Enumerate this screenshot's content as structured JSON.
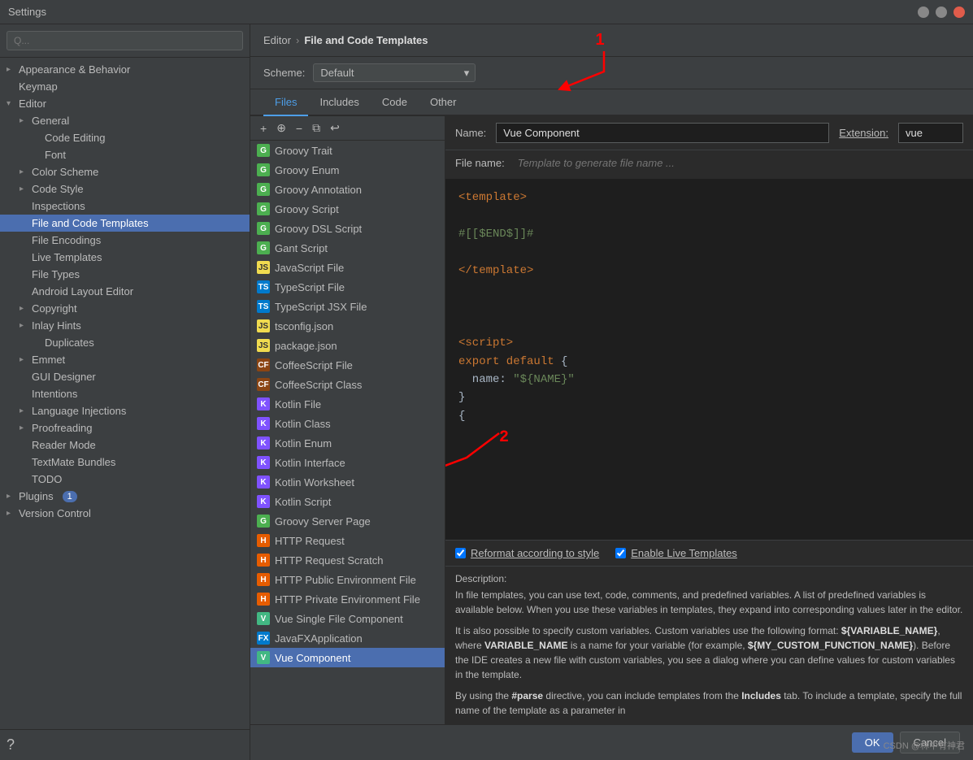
{
  "titleBar": {
    "title": "Settings"
  },
  "search": {
    "placeholder": "Q..."
  },
  "sidebar": {
    "sections": [
      {
        "id": "appearance",
        "label": "Appearance & Behavior",
        "level": 0,
        "hasArrow": true,
        "expanded": false
      },
      {
        "id": "keymap",
        "label": "Keymap",
        "level": 0,
        "hasArrow": false
      },
      {
        "id": "editor",
        "label": "Editor",
        "level": 0,
        "hasArrow": true,
        "expanded": true
      },
      {
        "id": "general",
        "label": "General",
        "level": 1,
        "hasArrow": true
      },
      {
        "id": "code-editing",
        "label": "Code Editing",
        "level": 2,
        "hasArrow": false
      },
      {
        "id": "font",
        "label": "Font",
        "level": 2,
        "hasArrow": false
      },
      {
        "id": "color-scheme",
        "label": "Color Scheme",
        "level": 1,
        "hasArrow": true
      },
      {
        "id": "code-style",
        "label": "Code Style",
        "level": 1,
        "hasArrow": true
      },
      {
        "id": "inspections",
        "label": "Inspections",
        "level": 1,
        "hasArrow": false
      },
      {
        "id": "file-code-templates",
        "label": "File and Code Templates",
        "level": 1,
        "hasArrow": false,
        "selected": true
      },
      {
        "id": "file-encodings",
        "label": "File Encodings",
        "level": 1,
        "hasArrow": false
      },
      {
        "id": "live-templates",
        "label": "Live Templates",
        "level": 1,
        "hasArrow": false
      },
      {
        "id": "file-types",
        "label": "File Types",
        "level": 1,
        "hasArrow": false
      },
      {
        "id": "android-layout",
        "label": "Android Layout Editor",
        "level": 1,
        "hasArrow": false
      },
      {
        "id": "copyright",
        "label": "Copyright",
        "level": 1,
        "hasArrow": true
      },
      {
        "id": "inlay-hints",
        "label": "Inlay Hints",
        "level": 1,
        "hasArrow": true
      },
      {
        "id": "duplicates",
        "label": "Duplicates",
        "level": 2,
        "hasArrow": false
      },
      {
        "id": "emmet",
        "label": "Emmet",
        "level": 1,
        "hasArrow": true
      },
      {
        "id": "gui-designer",
        "label": "GUI Designer",
        "level": 1,
        "hasArrow": false
      },
      {
        "id": "intentions",
        "label": "Intentions",
        "level": 1,
        "hasArrow": false
      },
      {
        "id": "language-injections",
        "label": "Language Injections",
        "level": 1,
        "hasArrow": true
      },
      {
        "id": "proofreading",
        "label": "Proofreading",
        "level": 1,
        "hasArrow": true
      },
      {
        "id": "reader-mode",
        "label": "Reader Mode",
        "level": 1,
        "hasArrow": false
      },
      {
        "id": "textmate-bundles",
        "label": "TextMate Bundles",
        "level": 1,
        "hasArrow": false
      },
      {
        "id": "todo",
        "label": "TODO",
        "level": 1,
        "hasArrow": false
      },
      {
        "id": "plugins",
        "label": "Plugins",
        "level": 0,
        "hasArrow": true,
        "badge": "1"
      },
      {
        "id": "version-control",
        "label": "Version Control",
        "level": 0,
        "hasArrow": true
      }
    ]
  },
  "breadcrumb": {
    "parent": "Editor",
    "current": "File and Code Templates"
  },
  "scheme": {
    "label": "Scheme:",
    "value": "Default"
  },
  "tabs": [
    {
      "id": "files",
      "label": "Files",
      "active": true
    },
    {
      "id": "includes",
      "label": "Includes"
    },
    {
      "id": "code",
      "label": "Code"
    },
    {
      "id": "other",
      "label": "Other"
    }
  ],
  "toolbar": {
    "add": "+",
    "copy": "⊕",
    "remove": "−",
    "paste": "⧉",
    "reset": "↩"
  },
  "fileList": [
    {
      "id": "groovy-trait",
      "label": "Groovy Trait",
      "icon": "G",
      "iconClass": "icon-g"
    },
    {
      "id": "groovy-enum",
      "label": "Groovy Enum",
      "icon": "G",
      "iconClass": "icon-g"
    },
    {
      "id": "groovy-annotation",
      "label": "Groovy Annotation",
      "icon": "G",
      "iconClass": "icon-g"
    },
    {
      "id": "groovy-script",
      "label": "Groovy Script",
      "icon": "G",
      "iconClass": "icon-g"
    },
    {
      "id": "groovy-dsl-script",
      "label": "Groovy DSL Script",
      "icon": "G",
      "iconClass": "icon-g"
    },
    {
      "id": "gant-script",
      "label": "Gant Script",
      "icon": "G",
      "iconClass": "icon-g"
    },
    {
      "id": "javascript-file",
      "label": "JavaScript File",
      "icon": "JS",
      "iconClass": "icon-js"
    },
    {
      "id": "typescript-file",
      "label": "TypeScript File",
      "icon": "TS",
      "iconClass": "icon-ts"
    },
    {
      "id": "typescript-jsx-file",
      "label": "TypeScript JSX File",
      "icon": "TS",
      "iconClass": "icon-ts"
    },
    {
      "id": "tsconfig-json",
      "label": "tsconfig.json",
      "icon": "JS",
      "iconClass": "icon-js"
    },
    {
      "id": "package-json",
      "label": "package.json",
      "icon": "JS",
      "iconClass": "icon-js"
    },
    {
      "id": "coffeescript-file",
      "label": "CoffeeScript File",
      "icon": "CF",
      "iconClass": "icon-coffee"
    },
    {
      "id": "coffeescript-class",
      "label": "CoffeeScript Class",
      "icon": "CF",
      "iconClass": "icon-coffee"
    },
    {
      "id": "kotlin-file",
      "label": "Kotlin File",
      "icon": "K",
      "iconClass": "icon-kotlin"
    },
    {
      "id": "kotlin-class",
      "label": "Kotlin Class",
      "icon": "K",
      "iconClass": "icon-kotlin"
    },
    {
      "id": "kotlin-enum",
      "label": "Kotlin Enum",
      "icon": "K",
      "iconClass": "icon-kotlin"
    },
    {
      "id": "kotlin-interface",
      "label": "Kotlin Interface",
      "icon": "K",
      "iconClass": "icon-kotlin"
    },
    {
      "id": "kotlin-worksheet",
      "label": "Kotlin Worksheet",
      "icon": "K",
      "iconClass": "icon-kotlin"
    },
    {
      "id": "kotlin-script",
      "label": "Kotlin Script",
      "icon": "K",
      "iconClass": "icon-kotlin"
    },
    {
      "id": "groovy-server-page",
      "label": "Groovy Server Page",
      "icon": "G",
      "iconClass": "icon-g"
    },
    {
      "id": "http-request",
      "label": "HTTP Request",
      "icon": "H",
      "iconClass": "icon-http"
    },
    {
      "id": "http-request-scratch",
      "label": "HTTP Request Scratch",
      "icon": "H",
      "iconClass": "icon-http"
    },
    {
      "id": "http-public-env-file",
      "label": "HTTP Public Environment File",
      "icon": "H",
      "iconClass": "icon-http"
    },
    {
      "id": "http-private-env-file",
      "label": "HTTP Private Environment File",
      "icon": "H",
      "iconClass": "icon-http"
    },
    {
      "id": "vue-single-file",
      "label": "Vue Single File Component",
      "icon": "V",
      "iconClass": "icon-vue"
    },
    {
      "id": "javafx-application",
      "label": "JavaFXApplication",
      "icon": "FX",
      "iconClass": "icon-fx"
    },
    {
      "id": "vue-component",
      "label": "Vue Component",
      "icon": "V",
      "iconClass": "icon-vue",
      "selected": true
    }
  ],
  "editor": {
    "nameLabel": "Name:",
    "nameValue": "Vue Component",
    "extLabel": "Extension:",
    "extValue": "vue",
    "filenamePlaceholder": "Template to generate file name ...",
    "code": [
      {
        "type": "tag",
        "text": "<template>"
      },
      {
        "type": "blank",
        "text": ""
      },
      {
        "type": "hash",
        "text": "#[[$END$]]#"
      },
      {
        "type": "blank",
        "text": ""
      },
      {
        "type": "tag",
        "text": "</template>"
      },
      {
        "type": "blank",
        "text": ""
      },
      {
        "type": "blank",
        "text": ""
      },
      {
        "type": "blank",
        "text": ""
      },
      {
        "type": "tag",
        "text": "<script>"
      },
      {
        "type": "keyword",
        "text": "export default {"
      },
      {
        "type": "normal",
        "text": "  name: \"${NAME}\""
      },
      {
        "type": "normal",
        "text": "}"
      },
      {
        "type": "incomplete",
        "text": "{"
      }
    ]
  },
  "options": {
    "reformat": {
      "checked": true,
      "label": "Reformat according to style"
    },
    "liveTemplates": {
      "checked": true,
      "label": "Enable Live Templates"
    }
  },
  "description": {
    "label": "Description:",
    "paragraphs": [
      "In file templates, you can use text, code, comments, and predefined variables. A list of predefined variables is available below. When you use these variables in templates, they expand into corresponding values later in the editor.",
      "It is also possible to specify custom variables. Custom variables use the following format: ${VARIABLE_NAME}, where VARIABLE_NAME is a name for your variable (for example, ${MY_CUSTOM_FUNCTION_NAME}). Before the IDE creates a new file with custom variables, you see a dialog where you can define values for custom variables in the template.",
      "By using the #parse directive, you can include templates from the Includes tab. To include a template, specify the full name of the template as a parameter in"
    ]
  },
  "bottomBar": {
    "ok": "OK",
    "cancel": "Cancel"
  },
  "annotations": {
    "num1": "1",
    "num2": "2"
  },
  "watermark": "CSDN @林中有神君"
}
